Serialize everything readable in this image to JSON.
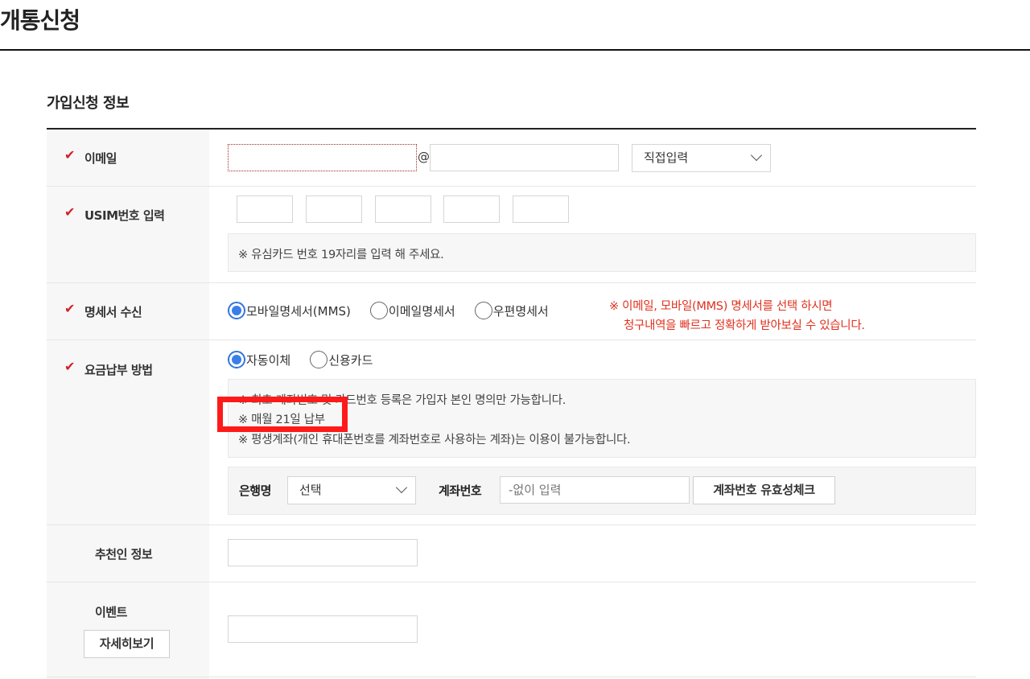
{
  "page": {
    "title": "개통신청"
  },
  "section": {
    "title": "가입신청 정보"
  },
  "email": {
    "label": "이메일",
    "at": "@",
    "domain_select": "직접입력"
  },
  "usim": {
    "label": "USIM번호 입력",
    "note": "※ 유심카드 번호 19자리를 입력 해 주세요."
  },
  "statement": {
    "label": "명세서 수신",
    "options": [
      "모바일명세서(MMS)",
      "이메일명세서",
      "우편명세서"
    ],
    "selected_index": 0,
    "warning_line1": "※ 이메일, 모바일(MMS) 명세서를 선택 하시면",
    "warning_line2": "청구내역을 빠르고 정확하게 받아보실 수 있습니다."
  },
  "payment": {
    "label": "요금납부 방법",
    "options": [
      "자동이체",
      "신용카드"
    ],
    "selected_index": 0,
    "notes": [
      "※ 최초 계좌번호 및 카드번호 등록은 가입자 본인 명의만 가능합니다.",
      "※ 매월 21일 납부",
      "※ 평생계좌(개인 휴대폰번호를 계좌번호로 사용하는 계좌)는 이용이 불가능합니다."
    ],
    "bank_label": "은행명",
    "bank_select": "선택",
    "account_label": "계좌번호",
    "account_placeholder": "-없이 입력",
    "verify_button": "계좌번호 유효성체크"
  },
  "referrer": {
    "label": "추천인 정보"
  },
  "event": {
    "label": "이벤트",
    "detail_button": "자세히보기"
  },
  "colors": {
    "check": "#d1202a",
    "warning": "#e0301e",
    "highlight": "#ff1a1a",
    "radio_on": "#3b7ee8"
  }
}
